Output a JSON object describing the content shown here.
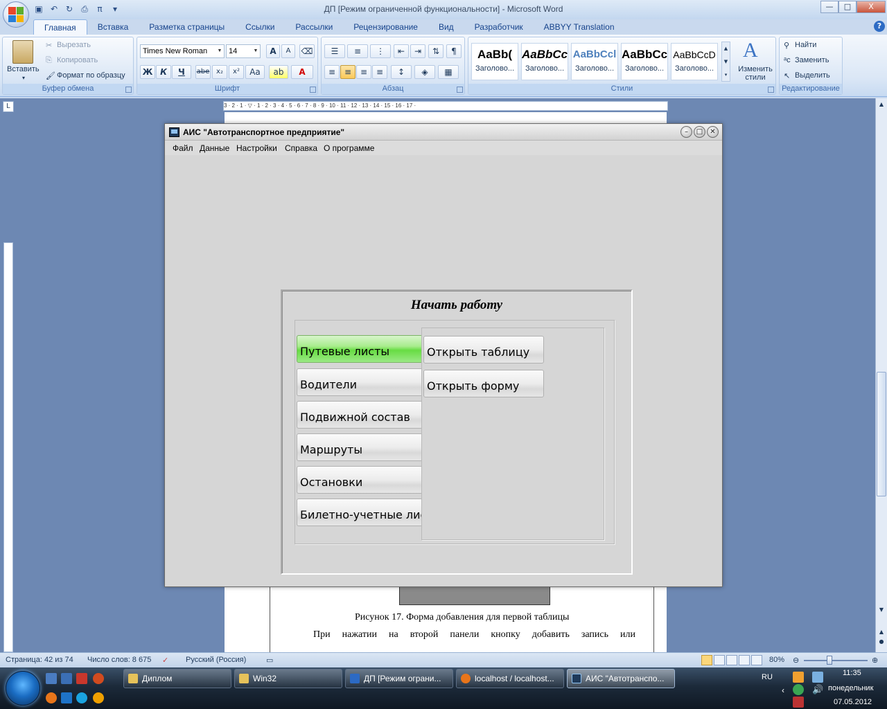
{
  "word": {
    "title": "ДП [Режим ограниченной функциональности] - Microsoft Word",
    "window_controls": {
      "minimize": "—",
      "maximize": "□",
      "close": "X"
    },
    "tabs": [
      "Главная",
      "Вставка",
      "Разметка страницы",
      "Ссылки",
      "Рассылки",
      "Рецензирование",
      "Вид",
      "Разработчик",
      "ABBYY Translation"
    ],
    "help": "?",
    "clipboard": {
      "label": "Буфер обмена",
      "paste": "Вставить",
      "cut": "Вырезать",
      "copy": "Копировать",
      "format_painter": "Формат по образцу"
    },
    "font": {
      "label": "Шрифт",
      "family": "Times New Roman",
      "size": "14",
      "grow": "A",
      "shrink": "A",
      "bold": "Ж",
      "italic": "К",
      "underline": "Ч",
      "strike": "abe",
      "sub": "x₂",
      "sup": "x²",
      "case": "Aa",
      "color": "A"
    },
    "paragraph": {
      "label": "Абзац",
      "pilcrow": "¶"
    },
    "styles": {
      "label": "Стили",
      "tiles": [
        {
          "preview": "AaBb(",
          "name": "Заголово..."
        },
        {
          "preview": "AaBbCc",
          "name": "Заголово..."
        },
        {
          "preview": "AaBbCcl",
          "name": "Заголово..."
        },
        {
          "preview": "AaBbCc",
          "name": "Заголово..."
        },
        {
          "preview": "AaBbCcD",
          "name": "Заголово..."
        }
      ],
      "change_styles": "Изменить стили"
    },
    "editing": {
      "label": "Редактирование",
      "find": "Найти",
      "replace": "Заменить",
      "select": "Выделить"
    },
    "ruler_text": "3 · 2 · 1 · ▽ · 1 · 2 · 3 · 4 · 5 · 6 · 7 · 8 · 9 · 10 · 11 · 12 · 13 · 14 · 15 · 16 · 17 ·",
    "tab_selector": "L",
    "document": {
      "caption": "Рисунок 17. Форма добавления для первой таблицы",
      "paragraph": "При нажатии на второй панели кнопку добавить запись или"
    },
    "status": {
      "page": "Страница: 42 из 74",
      "words": "Число слов: 8 675",
      "language": "Русский (Россия)",
      "zoom": "80%"
    }
  },
  "app": {
    "title": "АИС \"Автотранспортное предприятие\"",
    "menu": [
      "Файл",
      "Данные",
      "Настройки",
      "Справка",
      "О программе"
    ],
    "panel_title": "Начать работу",
    "nav_buttons": [
      "Путевые листы",
      "Водители",
      "Подвижной состав",
      "Маршруты",
      "Остановки",
      "Билетно-учетные листы"
    ],
    "active_nav": 0,
    "action_buttons": [
      "Открыть таблицу",
      "Открыть форму"
    ]
  },
  "taskbar": {
    "tasks": [
      "Диплом",
      "Win32",
      "ДП [Режим ограни...",
      "localhost / localhost...",
      "АИС \"Автотранспо..."
    ],
    "active_task": 4,
    "lang": "RU",
    "time": "11:35",
    "weekday": "понедельник",
    "date": "07.05.2012"
  },
  "colors": {
    "accent_green": "#67dc43",
    "word_blue": "#15428b"
  }
}
